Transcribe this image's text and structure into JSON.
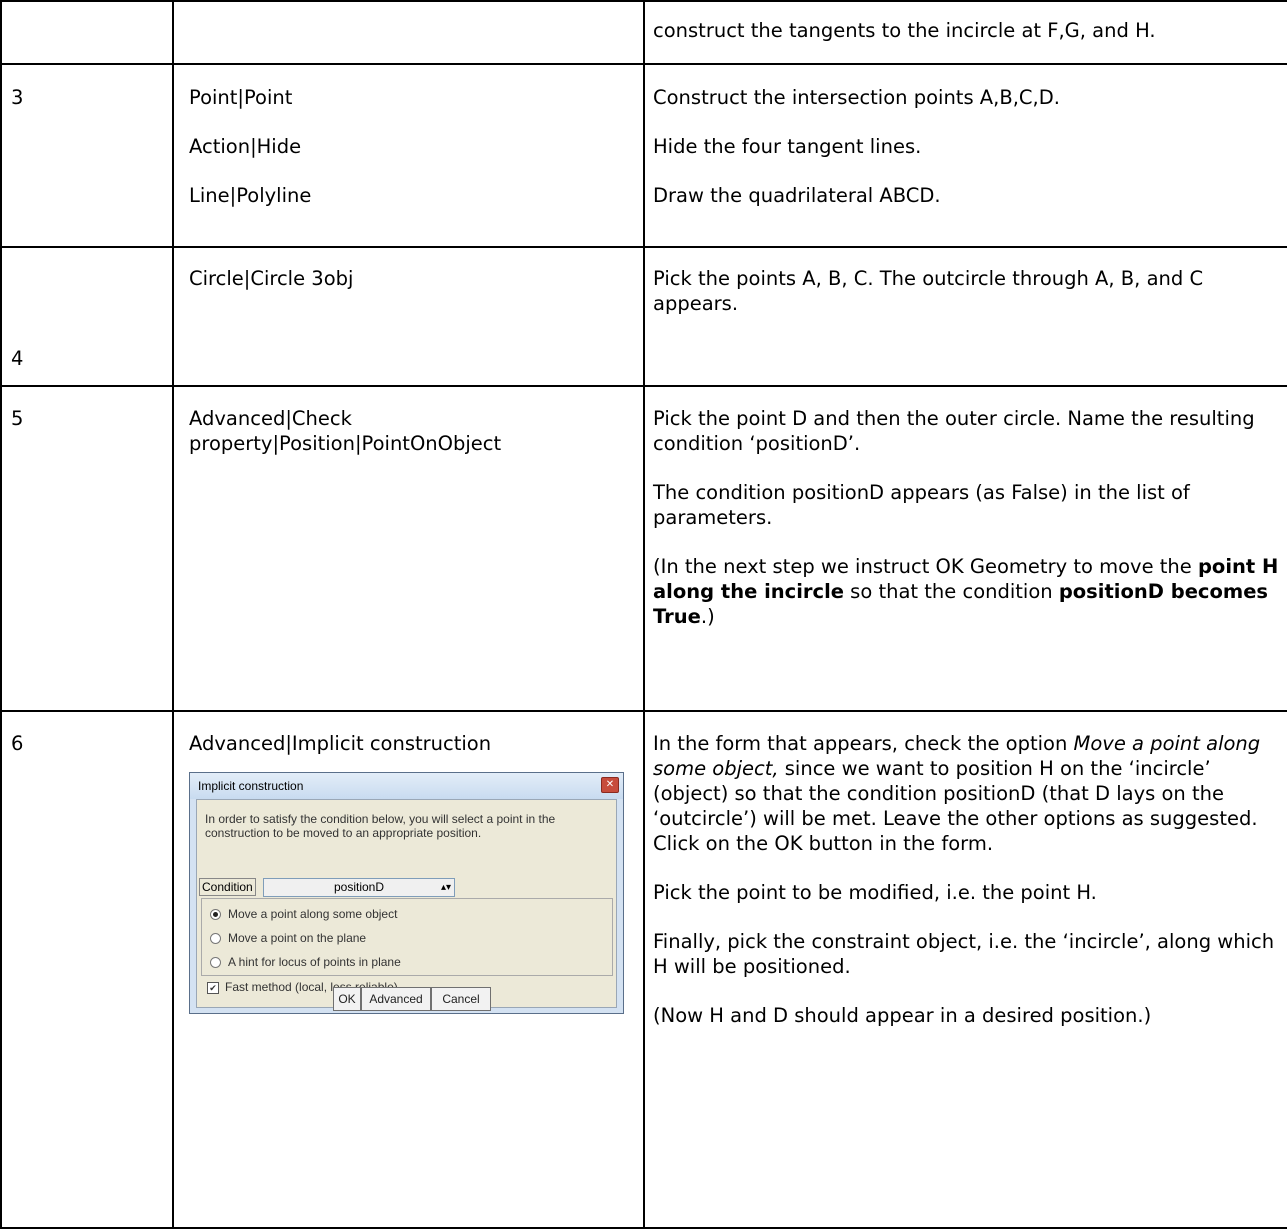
{
  "rows": [
    {
      "step": "",
      "menu": [],
      "description": [
        "construct the tangents to the incircle at F,G, and H."
      ]
    },
    {
      "step": "3",
      "menu": [
        "Point|Point",
        "Action|Hide",
        "Line|Polyline"
      ],
      "description": [
        "Construct the intersection points A,B,C,D.",
        "Hide the four tangent lines.",
        "Draw the quadrilateral ABCD."
      ]
    },
    {
      "step": "4",
      "menu": [
        "Circle|Circle 3obj"
      ],
      "description": [
        "Pick the points A, B, C. The outcircle through A, B, and C appears."
      ]
    },
    {
      "step": "5",
      "menu": [
        "Advanced|Check property|Position|PointOnObject"
      ],
      "description": [
        "Pick the point D and then the outer circle. Name the resulting condition ‘positionD’.",
        "The condition positionD appears (as False)  in the list of parameters."
      ],
      "rich": {
        "pre": "(In the next step we instruct OK Geometry to move the ",
        "bold1": "point H along the incircle",
        "mid": " so that the condition ",
        "bold2": "positionD becomes True",
        "post": ".)"
      }
    },
    {
      "step": "6",
      "menu": [
        "Advanced|Implicit construction"
      ],
      "first": {
        "pre": "In the form that appears, check the option ",
        "ital": "Move a point along some object,",
        "post": " since we want to position H on the ‘incircle’ (object) so that the condition positionD (that D lays on the ‘outcircle’) will be met. Leave the other options as suggested. Click on the OK button in the form."
      },
      "description": [
        "Pick the point to be modified, i.e. the point H.",
        "Finally, pick the constraint object, i.e. the ‘incircle’, along which H will be positioned.",
        "(Now H and D should appear in a desired position.)"
      ]
    }
  ],
  "dialog": {
    "title": "Implicit construction",
    "message": "In order to satisfy the condition below, you will select a point in the construction to be moved to an appropriate position.",
    "condition_label": "Condition",
    "condition_value": "positionD",
    "options": [
      "Move a point along some object",
      "Move a point on the plane",
      "A hint for locus of points in plane"
    ],
    "selected_option": 0,
    "checkbox_label": "Fast method (local, less reliable)",
    "checkbox_checked": true,
    "buttons": [
      "OK",
      "Advanced",
      "Cancel"
    ]
  }
}
